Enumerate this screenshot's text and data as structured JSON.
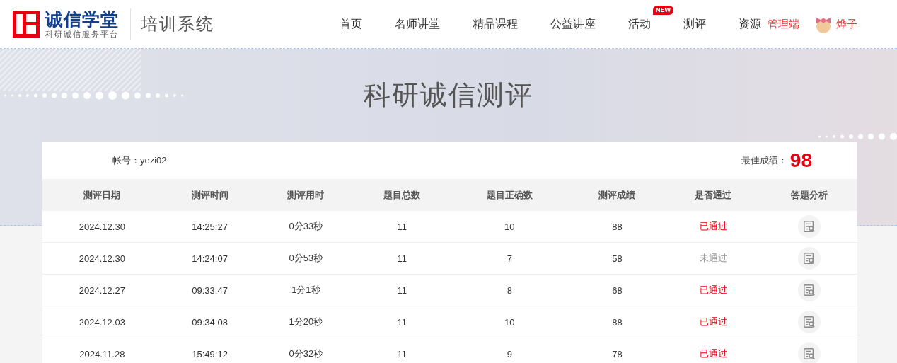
{
  "logo": {
    "name": "诚信学堂",
    "tagline": "科研诚信服务平台"
  },
  "system_title": "培训系统",
  "nav": [
    {
      "label": "首页"
    },
    {
      "label": "名师讲堂"
    },
    {
      "label": "精品课程"
    },
    {
      "label": "公益讲座"
    },
    {
      "label": "活动",
      "badge": "NEW"
    },
    {
      "label": "测评"
    },
    {
      "label": "资源"
    }
  ],
  "admin_link": "管理端",
  "user_name": "烨子",
  "banner_title": "科研诚信测评",
  "account": {
    "label": "帐号：",
    "value": "yezi02"
  },
  "best_score": {
    "label": "最佳成绩：",
    "value": "98"
  },
  "table": {
    "columns": [
      "测评日期",
      "测评时间",
      "测评用时",
      "题目总数",
      "题目正确数",
      "测评成绩",
      "是否通过",
      "答题分析"
    ],
    "rows": [
      {
        "date": "2024.12.30",
        "time": "14:25:27",
        "duration": "0分33秒",
        "total": "11",
        "correct": "10",
        "score": "88",
        "result": "已通过",
        "passed": true
      },
      {
        "date": "2024.12.30",
        "time": "14:24:07",
        "duration": "0分53秒",
        "total": "11",
        "correct": "7",
        "score": "58",
        "result": "未通过",
        "passed": false
      },
      {
        "date": "2024.12.27",
        "time": "09:33:47",
        "duration": "1分1秒",
        "total": "11",
        "correct": "8",
        "score": "68",
        "result": "已通过",
        "passed": true
      },
      {
        "date": "2024.12.03",
        "time": "09:34:08",
        "duration": "1分20秒",
        "total": "11",
        "correct": "10",
        "score": "88",
        "result": "已通过",
        "passed": true
      },
      {
        "date": "2024.11.28",
        "time": "15:49:12",
        "duration": "0分32秒",
        "total": "11",
        "correct": "9",
        "score": "78",
        "result": "已通过",
        "passed": true
      }
    ]
  }
}
